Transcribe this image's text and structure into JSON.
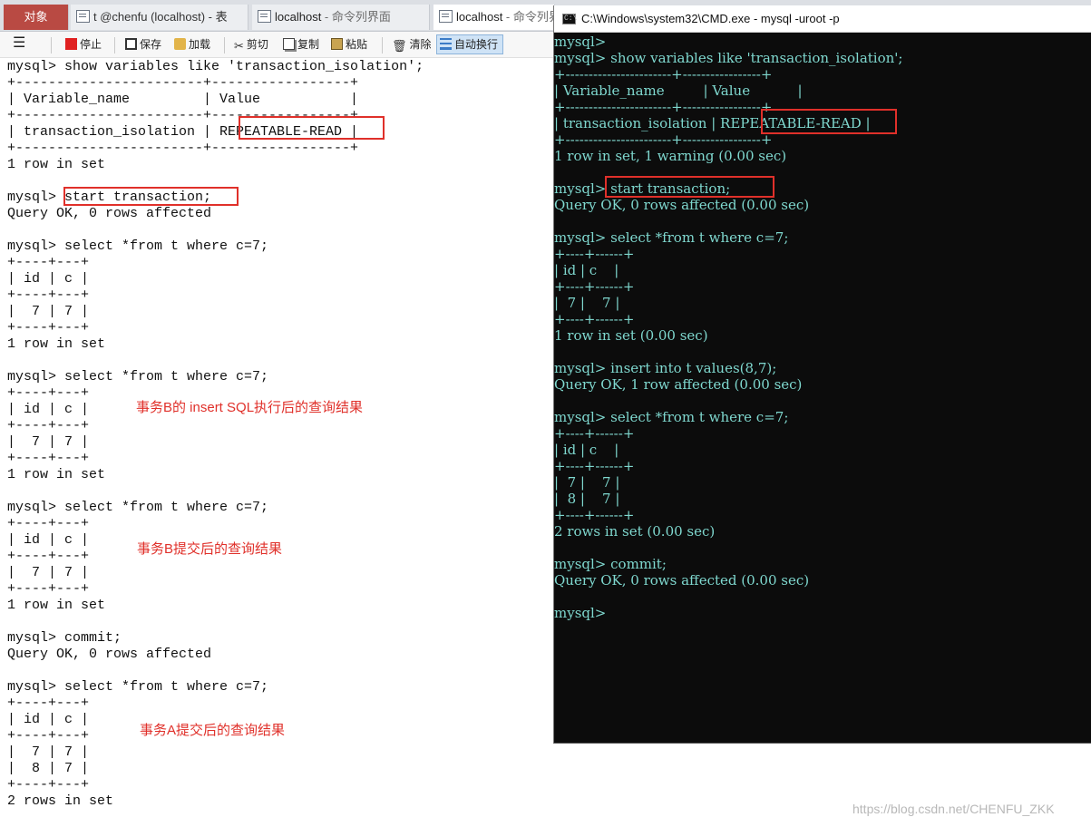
{
  "tabs": {
    "objects": "对象",
    "tab1": "t @chenfu (localhost) - 表",
    "tab2_main": "localhost",
    "tab2_sub": " - 命令列界面",
    "tab3_main": "localhost",
    "tab3_sub": " - 命令列界"
  },
  "toolbar": {
    "menu": "☰",
    "stop": "停止",
    "save": "保存",
    "load": "加载",
    "cut": "剪切",
    "copy": "复制",
    "paste": "粘贴",
    "clear": "清除",
    "wrap": "自动换行"
  },
  "left_console": {
    "lines": [
      "mysql> show variables like 'transaction_isolation';",
      "+-----------------------+-----------------+",
      "| Variable_name         | Value           |",
      "+-----------------------+-----------------+",
      "| transaction_isolation | REPEATABLE-READ |",
      "+-----------------------+-----------------+",
      "1 row in set",
      "",
      "mysql> start transaction;",
      "Query OK, 0 rows affected",
      "",
      "mysql> select *from t where c=7;",
      "+----+---+",
      "| id | c |",
      "+----+---+",
      "|  7 | 7 |",
      "+----+---+",
      "1 row in set",
      "",
      "mysql> select *from t where c=7;",
      "+----+---+",
      "| id | c |",
      "+----+---+",
      "|  7 | 7 |",
      "+----+---+",
      "1 row in set",
      "",
      "mysql> select *from t where c=7;",
      "+----+---+",
      "| id | c |",
      "+----+---+",
      "|  7 | 7 |",
      "+----+---+",
      "1 row in set",
      "",
      "mysql> commit;",
      "Query OK, 0 rows affected",
      "",
      "mysql> select *from t where c=7;",
      "+----+---+",
      "| id | c |",
      "+----+---+",
      "|  7 | 7 |",
      "|  8 | 7 |",
      "+----+---+",
      "2 rows in set"
    ],
    "annotations": [
      "事务B的 insert SQL执行后的查询结果",
      "事务B提交后的查询结果",
      "事务A提交后的查询结果"
    ]
  },
  "cmd_window": {
    "title": "C:\\Windows\\system32\\CMD.exe - mysql  -uroot -p",
    "icon_text": "C:\\",
    "lines": [
      "mysql>",
      "mysql> show variables like 'transaction_isolation';",
      "+-----------------------+-----------------+",
      "| Variable_name         | Value           |",
      "+-----------------------+-----------------+",
      "| transaction_isolation | REPEATABLE-READ |",
      "+-----------------------+-----------------+",
      "1 row in set, 1 warning (0.00 sec)",
      "",
      "mysql> start transaction;",
      "Query OK, 0 rows affected (0.00 sec)",
      "",
      "mysql> select *from t where c=7;",
      "+----+------+",
      "| id | c    |",
      "+----+------+",
      "|  7 |    7 |",
      "+----+------+",
      "1 row in set (0.00 sec)",
      "",
      "mysql> insert into t values(8,7);",
      "Query OK, 1 row affected (0.00 sec)",
      "",
      "mysql> select *from t where c=7;",
      "+----+------+",
      "| id | c    |",
      "+----+------+",
      "|  7 |    7 |",
      "|  8 |    7 |",
      "+----+------+",
      "2 rows in set (0.00 sec)",
      "",
      "mysql> commit;",
      "Query OK, 0 rows affected (0.00 sec)",
      "",
      "mysql>"
    ]
  },
  "watermark": "https://blog.csdn.net/CHENFU_ZKK",
  "colors": {
    "highlight_box": "#e0302a",
    "cmd_text": "#7fd8cf",
    "cmd_background": "#0c0c0c",
    "objects_tab": "#b94a43"
  }
}
